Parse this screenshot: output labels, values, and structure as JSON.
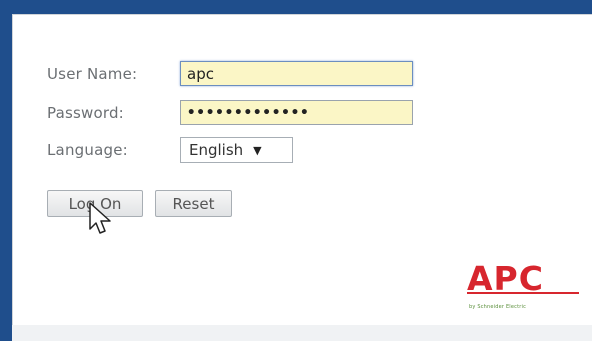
{
  "form": {
    "username_label": "User Name:",
    "username_value": "apc",
    "password_label": "Password:",
    "password_value": "•••••••••••••",
    "language_label": "Language:",
    "language_selected": "English",
    "language_arrow": "▼"
  },
  "buttons": {
    "logon": "Log On",
    "reset": "Reset"
  },
  "brand": {
    "logo_text": "APC",
    "logo_sub": "by Schneider Electric",
    "logo_color": "#d7262e"
  },
  "colors": {
    "frame": "#1f4e8c",
    "input_bg": "#fbf6c6"
  }
}
